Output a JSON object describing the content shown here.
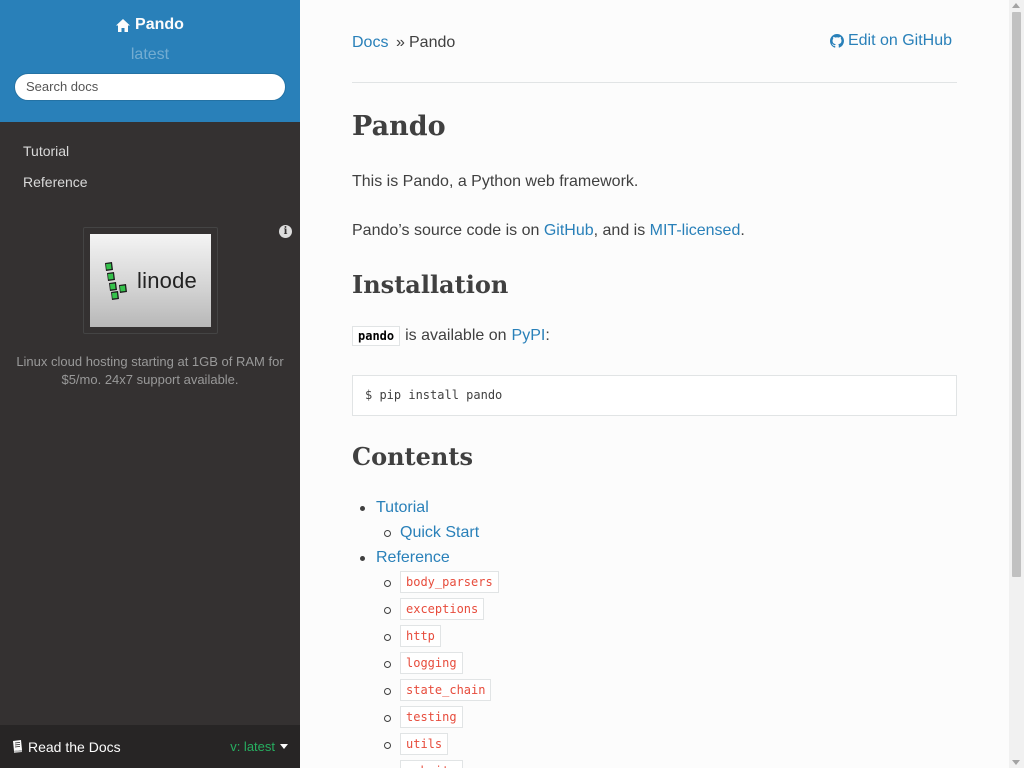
{
  "sidebar": {
    "project_name": "Pando",
    "version": "latest",
    "search_placeholder": "Search docs",
    "nav": [
      {
        "label": "Tutorial"
      },
      {
        "label": "Reference"
      }
    ],
    "ad": {
      "image_text": "linode",
      "description": "Linux cloud hosting starting at 1GB of RAM for $5/mo. 24x7 support available.",
      "info_symbol": "i"
    },
    "footer": {
      "rtd_label": "Read the Docs",
      "version_label": "v: latest"
    }
  },
  "breadcrumbs": {
    "docs": "Docs",
    "separator": "»",
    "current": "Pando",
    "edit_label": "Edit on GitHub"
  },
  "main": {
    "title": "Pando",
    "intro": "This is Pando, a Python web framework.",
    "source_prefix": "Pando’s source code is on ",
    "source_link": "GitHub",
    "source_middle": ", and is ",
    "license_link": "MIT-licensed",
    "source_suffix": ".",
    "installation_heading": "Installation",
    "install_code": "pando",
    "install_text": "is available on",
    "pypi_link": "PyPI",
    "install_suffix": ":",
    "install_command": "$ pip install pando",
    "contents_heading": "Contents",
    "toc": {
      "tutorial": "Tutorial",
      "quick_start": "Quick Start",
      "reference": "Reference",
      "modules": [
        "body_parsers",
        "exceptions",
        "http",
        "logging",
        "state_chain",
        "testing",
        "utils",
        "website"
      ]
    }
  },
  "colors": {
    "sidebar_top": "#2980b9",
    "sidebar_bg": "#343131",
    "link": "#2980b9",
    "code_red": "#e74c3c",
    "version_green": "#27ae60"
  },
  "icons": {
    "home": "home-icon",
    "github": "github-icon",
    "book": "book-icon",
    "info": "info-icon",
    "caret": "caret-down-icon"
  }
}
